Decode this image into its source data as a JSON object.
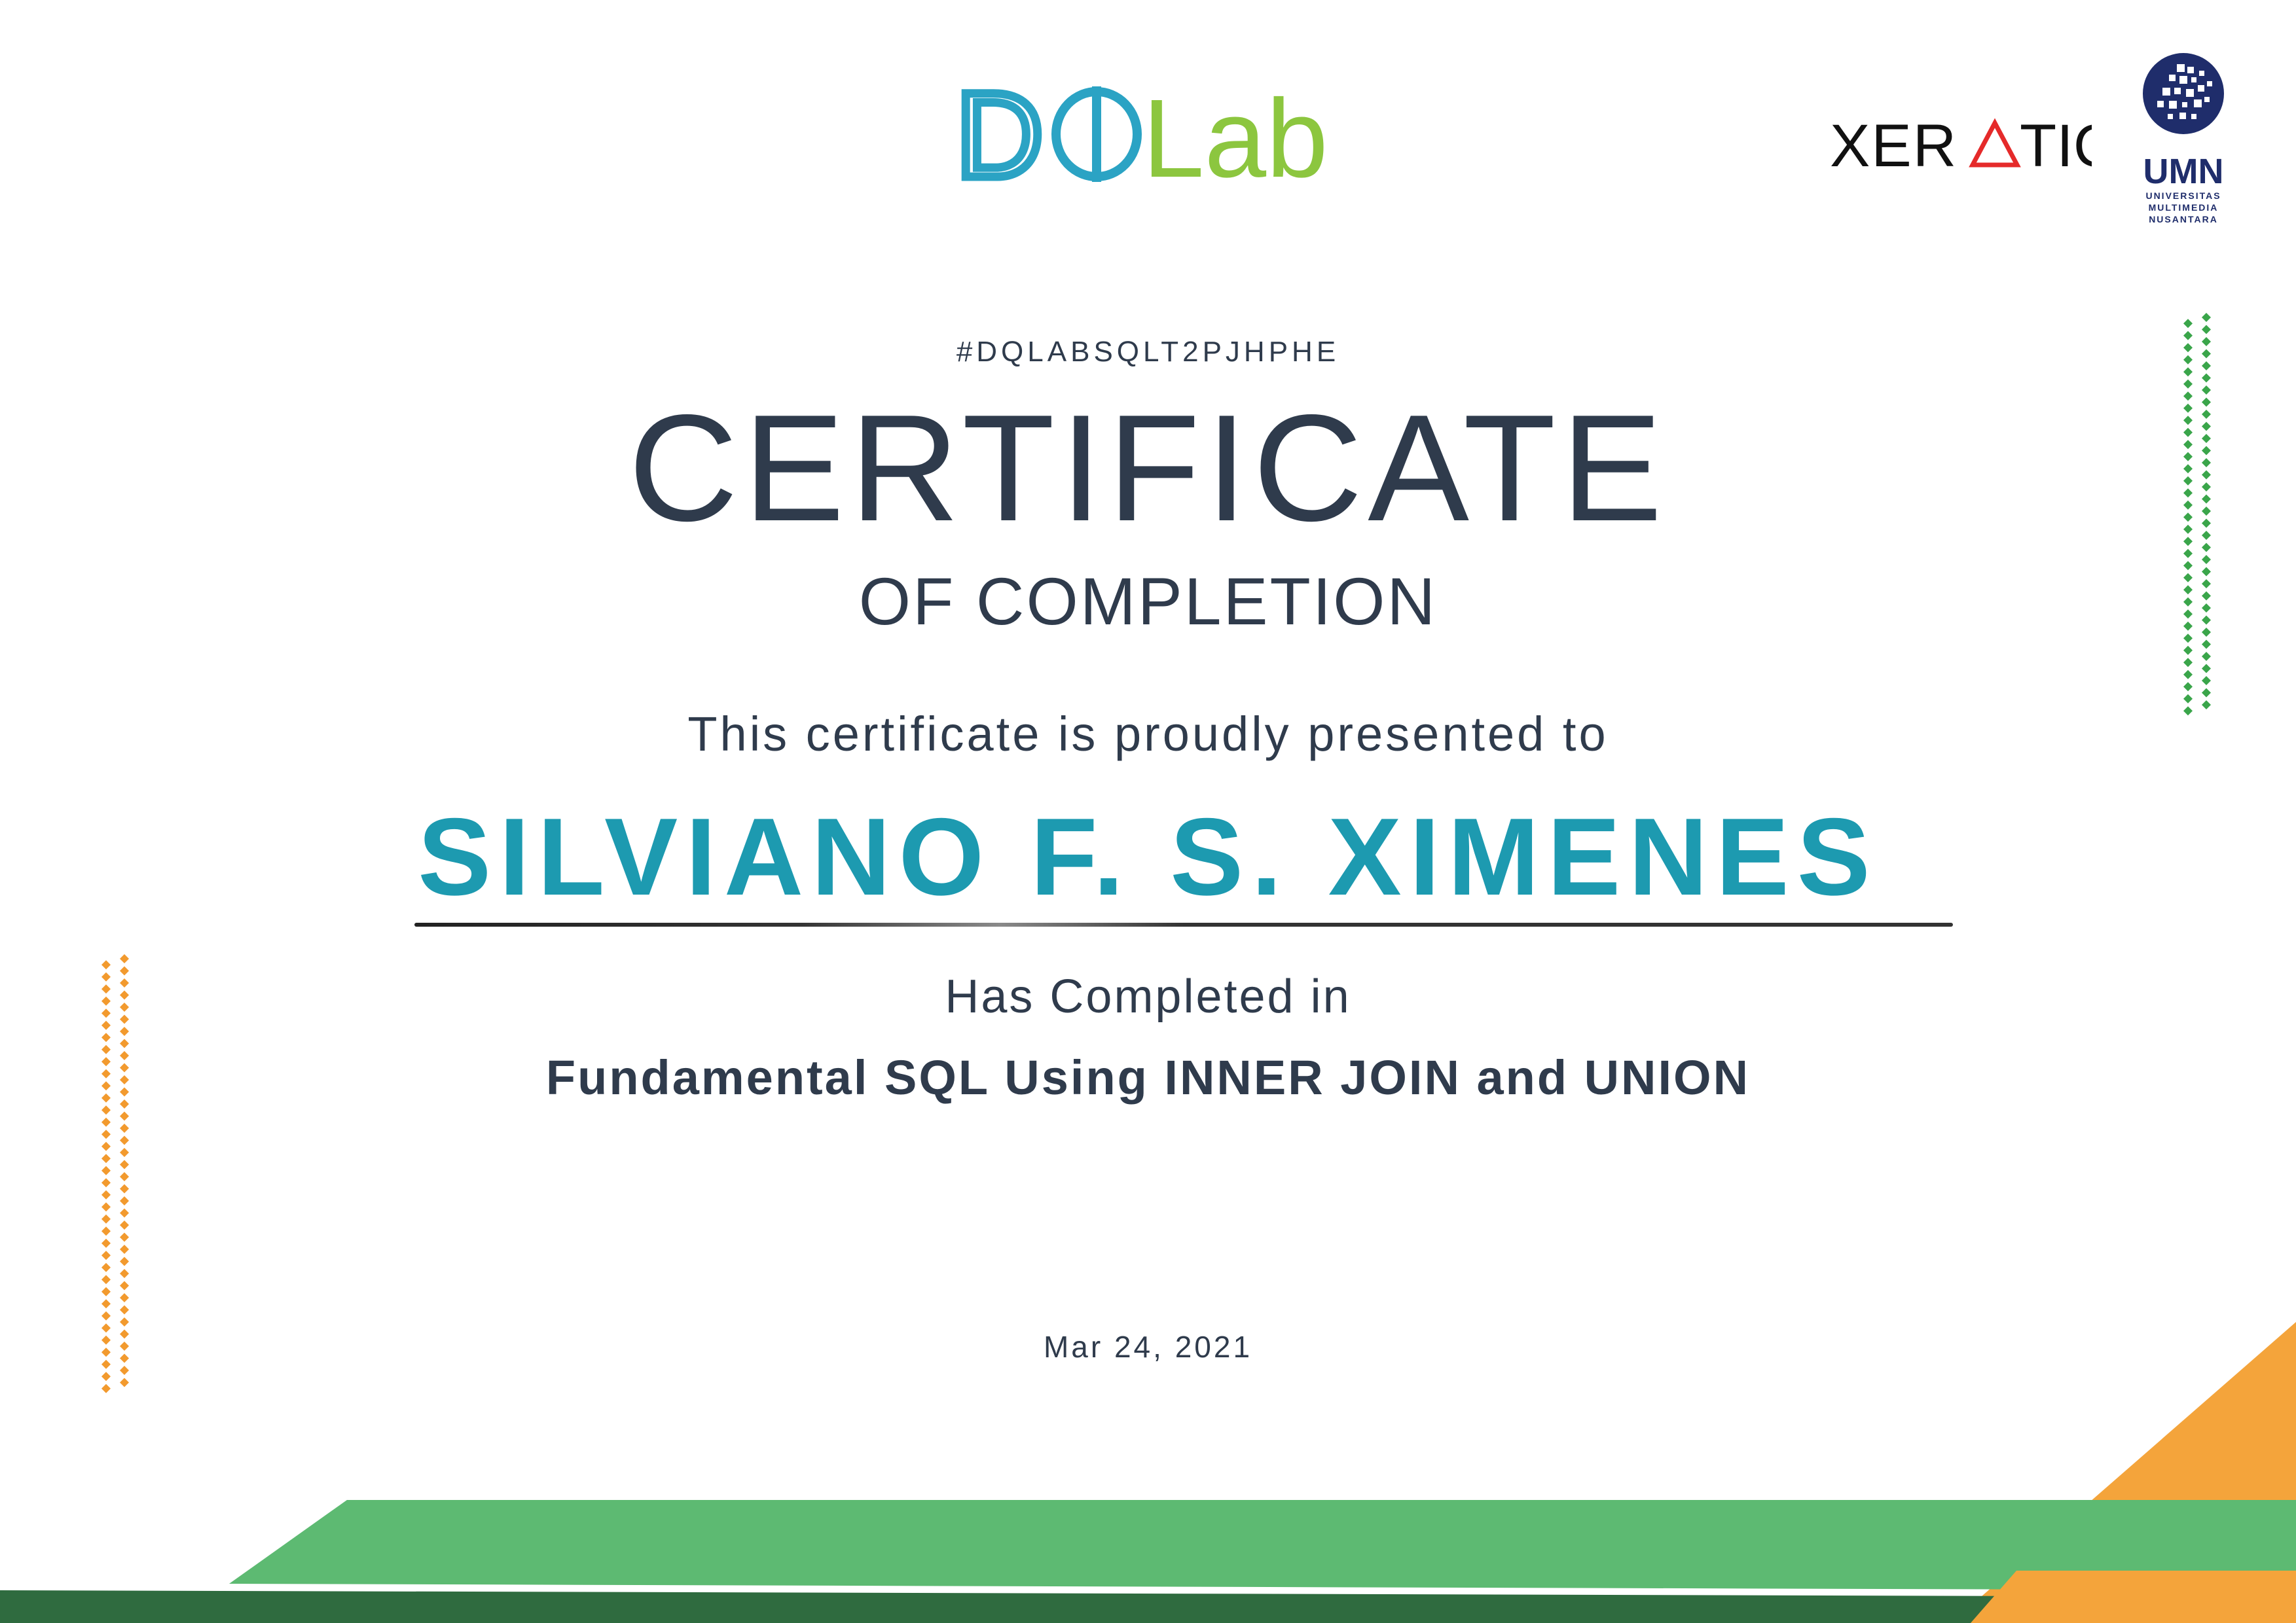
{
  "logos": {
    "dqlab": {
      "text_d": "D",
      "text_q": "Q",
      "text_lab": "Lab"
    },
    "xeratic": {
      "text_left": "XER",
      "text_right": "TIC"
    },
    "umn": {
      "abbr": "UMN",
      "line1": "UNIVERSITAS",
      "line2": "MULTIMEDIA",
      "line3": "NUSANTARA"
    }
  },
  "certificate": {
    "id": "#DQLABSQLT2PJHPHE",
    "title": "CERTIFICATE",
    "subtitle": "OF COMPLETION",
    "presented_text": "This certificate is proudly presented to",
    "recipient": "SILVIANO F. S. XIMENES",
    "completed_text": "Has Completed in",
    "course": "Fundamental SQL Using INNER JOIN and UNION",
    "date": "Mar 24, 2021"
  },
  "colors": {
    "text_dark": "#2f3b4c",
    "recipient": "#1d9ab0",
    "dqlab_blue": "#2ba3c4",
    "dqlab_green": "#8cc63f",
    "band_green": "#5dba72",
    "band_dark_green": "#2f6b3f",
    "band_orange": "#f4a43b",
    "dots_green": "#3aa54a",
    "dots_orange": "#f29a2e",
    "umn_navy": "#1f2d6b",
    "xeratic_red": "#e52a2a"
  }
}
